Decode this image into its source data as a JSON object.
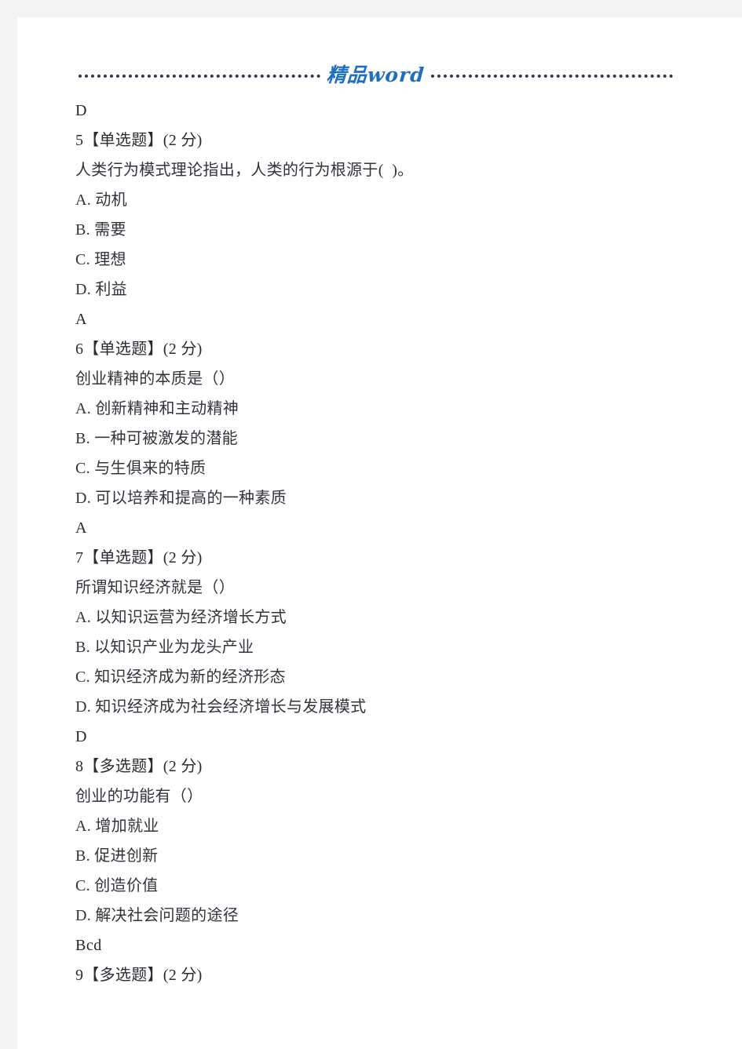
{
  "page": {
    "header_brand": "精品word",
    "header_rule_left": "dotted-rule",
    "header_rule_right": "dotted-rule"
  },
  "content": {
    "leading_answer": "D",
    "questions": [
      {
        "heading": "5【单选题】(2 分)",
        "number": "5",
        "type": "单选题",
        "points": "2 分",
        "stem": "人类行为模式理论指出，人类的行为根源于(  )。",
        "options": [
          "A. 动机",
          "B. 需要",
          "C. 理想",
          "D. 利益"
        ],
        "answer": "A"
      },
      {
        "heading": "6【单选题】(2 分)",
        "number": "6",
        "type": "单选题",
        "points": "2 分",
        "stem": "创业精神的本质是（）",
        "options": [
          "A. 创新精神和主动精神",
          "B. 一种可被激发的潜能",
          "C. 与生俱来的特质",
          "D. 可以培养和提高的一种素质"
        ],
        "answer": "A"
      },
      {
        "heading": "7【单选题】(2 分)",
        "number": "7",
        "type": "单选题",
        "points": "2 分",
        "stem": "所谓知识经济就是（）",
        "options": [
          "A. 以知识运营为经济增长方式",
          "B. 以知识产业为龙头产业",
          "C. 知识经济成为新的经济形态",
          "D. 知识经济成为社会经济增长与发展模式"
        ],
        "answer": "D"
      },
      {
        "heading": "8【多选题】(2 分)",
        "number": "8",
        "type": "多选题",
        "points": "2 分",
        "stem": "创业的功能有（）",
        "options": [
          "A. 增加就业",
          "B. 促进创新",
          "C. 创造价值",
          "D. 解决社会问题的途径"
        ],
        "answer": "Bcd"
      },
      {
        "heading": "9【多选题】(2 分)",
        "number": "9",
        "type": "多选题",
        "points": "2 分",
        "stem": "",
        "options": [],
        "answer": ""
      }
    ]
  },
  "colors": {
    "brand_blue": "#1f6fc0",
    "body_text": "#2b2b33",
    "rule": "#2f3a4b",
    "page_background": "#ffffff",
    "gutter_background": "#f4f4f5"
  }
}
